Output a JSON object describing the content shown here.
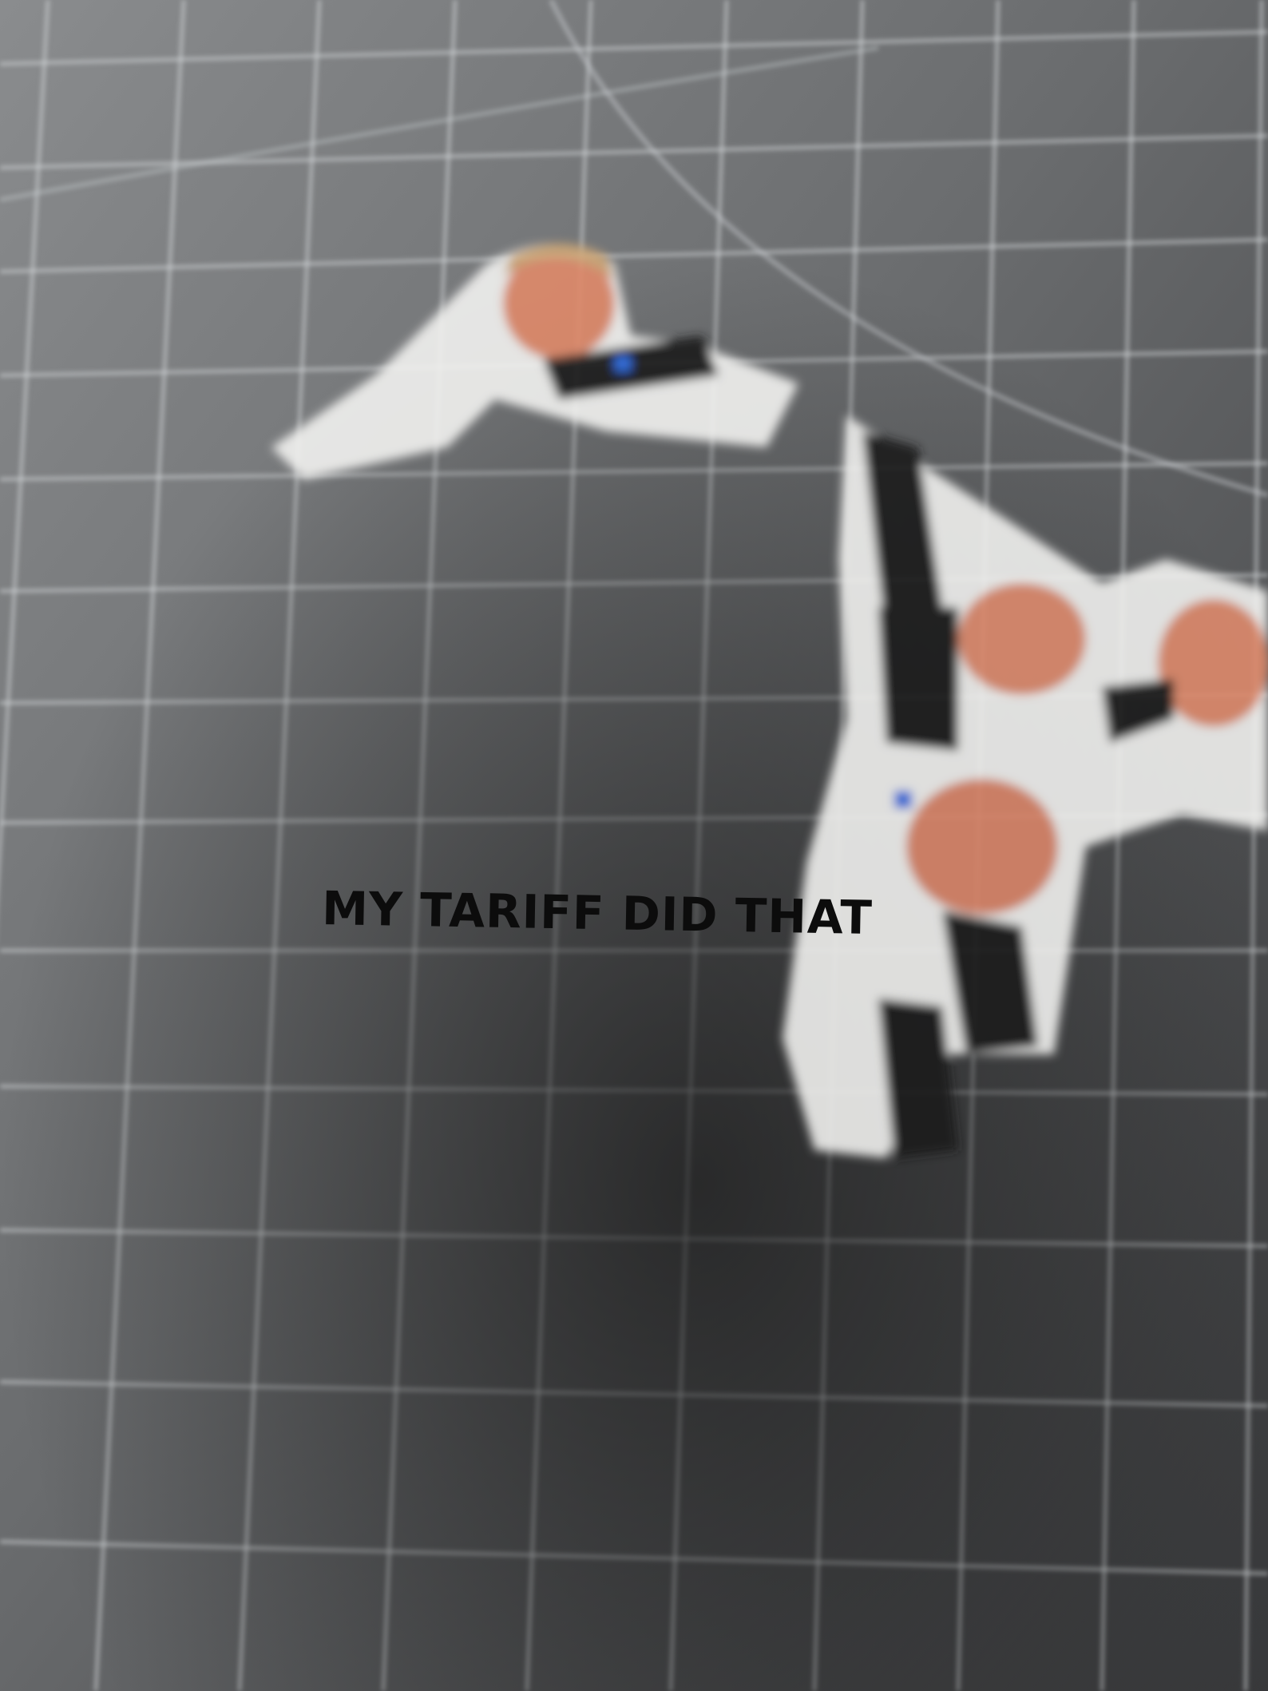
{
  "photo": {
    "subject": "hand holding a die-cut vinyl sticker over a cutting mat",
    "colors": {
      "mat": "#5f6163",
      "mat_dark": "#2e2f31",
      "grid_line": "#cfd3d6",
      "skin": "#e9a98f",
      "skin_shadow": "#c97d69",
      "sticker_border": "#f7f7f5",
      "suit": "#121418",
      "tie": "#1d5fd0",
      "caption_text": "#0c0c0c"
    }
  },
  "sticker": {
    "caption": "MY TARIFF DID THAT",
    "icons": [
      "person-portrait-icon",
      "pointing-finger-icon",
      "blue-tie-icon"
    ]
  }
}
